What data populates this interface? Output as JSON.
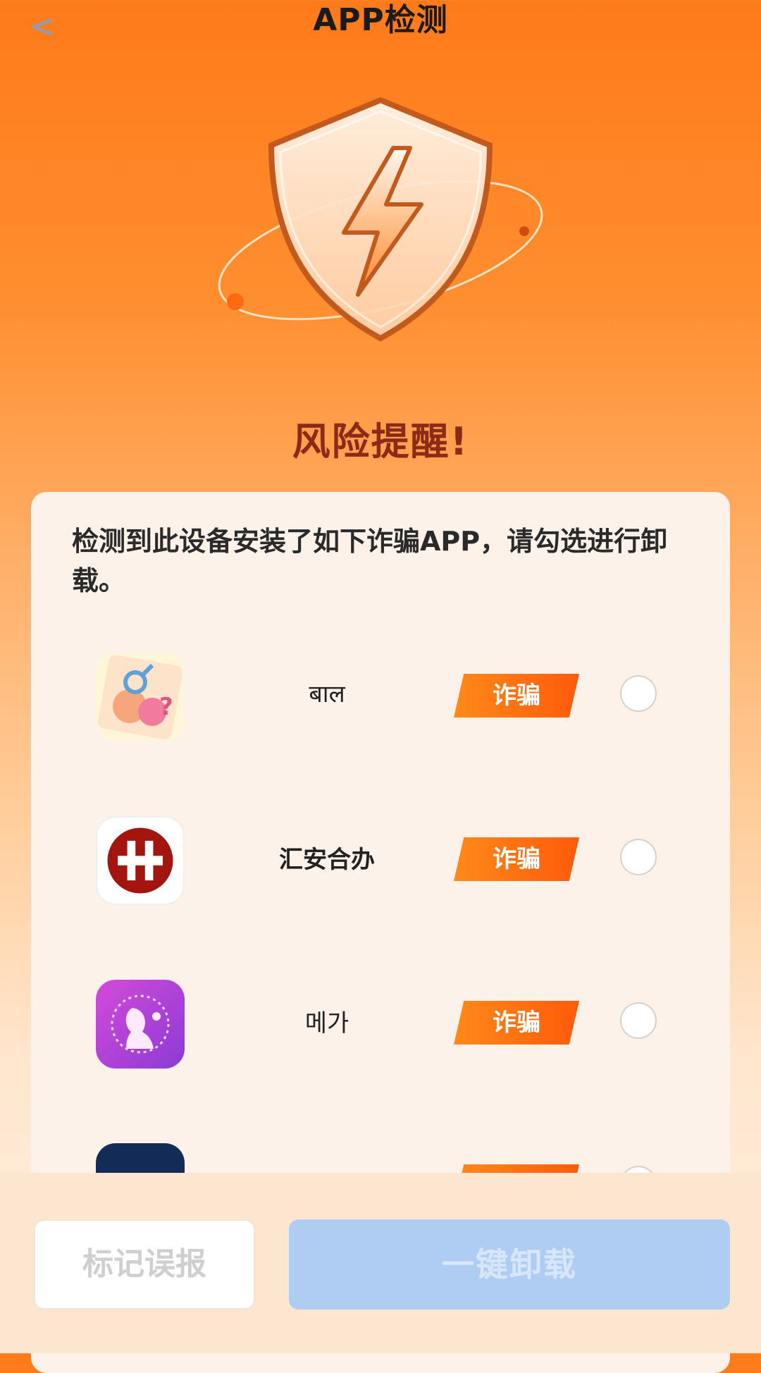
{
  "header": {
    "back_label": "<",
    "title": "APP检测"
  },
  "hero": {
    "risk_title": "风险提醒!"
  },
  "card": {
    "description": "检测到此设备安装了如下诈骗APP，请勾选进行卸载。",
    "apps": [
      {
        "name": "बाल",
        "tag": "诈骗",
        "icon": "gender-symbols-cartoon-icon",
        "selected": false
      },
      {
        "name": "汇安合办",
        "tag": "诈骗",
        "icon": "red-circle-h-logo-icon",
        "selected": false
      },
      {
        "name": "메가",
        "tag": "诈骗",
        "icon": "purple-silhouette-woman-icon",
        "selected": false
      },
      {
        "name": "",
        "tag": "诈骗",
        "icon": "navy-square-app-icon",
        "selected": false
      }
    ]
  },
  "actions": {
    "mark_false_label": "标记误报",
    "uninstall_label": "一键卸载"
  },
  "colors": {
    "accent": "#ff6a10",
    "risk_text": "#8b2b17",
    "disabled_primary": "#afcdf2"
  }
}
